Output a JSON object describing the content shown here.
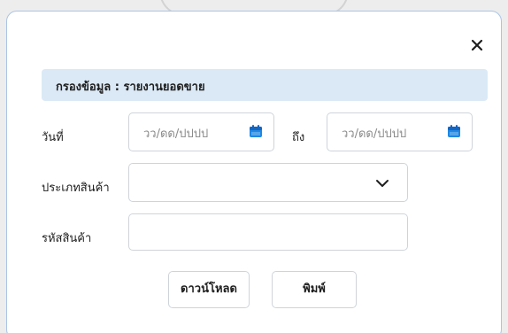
{
  "dialog": {
    "title": "กรองข้อมูล : รายงานยอดขาย",
    "close_icon": "close-icon"
  },
  "form": {
    "date_label": "วันที่",
    "to_label": "ถึง",
    "date_from_placeholder": "วว/ดด/ปปปป",
    "date_to_placeholder": "วว/ดด/ปปปป",
    "product_type_label": "ประเภทสินค้า",
    "product_type_value": "",
    "product_code_label": "รหัสสินค้า",
    "product_code_value": ""
  },
  "actions": {
    "download_label": "ดาวน์โหลด",
    "print_label": "พิมพ์"
  },
  "colors": {
    "header_bg": "#dbe9f6",
    "accent_icon": "#1e88e5",
    "modal_border": "#aac4e6"
  }
}
